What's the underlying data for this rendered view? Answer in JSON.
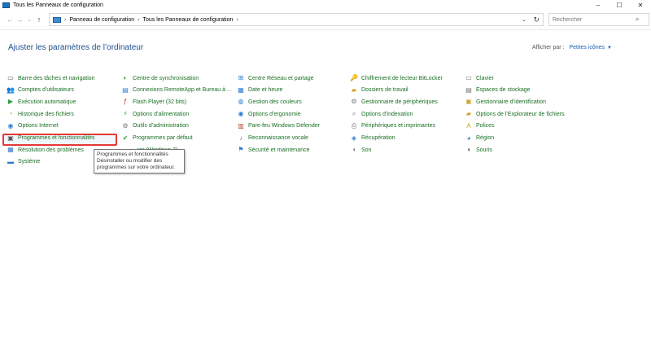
{
  "window": {
    "title": "Tous les Panneaux de configuration",
    "controls": [
      "–",
      "☐",
      "✕"
    ]
  },
  "nav": {
    "back": "←",
    "forward": "→",
    "dropdown": "⌄",
    "up": "↑"
  },
  "address": {
    "separator": "›",
    "crumbs": [
      "Panneau de configuration",
      "Tous les Panneaux de configuration"
    ],
    "dropdown": "⌄",
    "refresh": "↻"
  },
  "search": {
    "placeholder": "Rechercher",
    "icon": "search-icon",
    "icon_glyph": "⌕"
  },
  "heading": "Ajuster les paramètres de l’ordinateur",
  "view_by": {
    "label": "Afficher par :",
    "value": "Petites icônes",
    "caret": "▼"
  },
  "columns": [
    [
      {
        "label": "Barre des tâches et navigation",
        "icon": "taskbar-icon",
        "glyph": "▭",
        "color": "#666666"
      },
      {
        "label": "Comptes d’utilisateurs",
        "icon": "user-accounts-icon",
        "glyph": "👥",
        "color": "#2e7dd1"
      },
      {
        "label": "Exécution automatique",
        "icon": "autoplay-icon",
        "glyph": "▶",
        "color": "#2e9d3e"
      },
      {
        "label": "Historique des fichiers",
        "icon": "file-history-icon",
        "glyph": "◔",
        "color": "#d4a015"
      },
      {
        "label": "Options Internet",
        "icon": "internet-options-icon",
        "glyph": "◉",
        "color": "#2e7dd1"
      },
      {
        "label": "Programmes et fonctionnalités",
        "icon": "programs-icon",
        "glyph": "▣",
        "color": "#555555"
      },
      {
        "label": "Résolution des problèmes",
        "icon": "troubleshoot-icon",
        "glyph": "▦",
        "color": "#2e7dd1"
      },
      {
        "label": "Système",
        "icon": "system-icon",
        "glyph": "▬",
        "color": "#2e7dd1"
      }
    ],
    [
      {
        "label": "Centre de synchronisation",
        "icon": "sync-center-icon",
        "glyph": "◐",
        "color": "#2e9d3e"
      },
      {
        "label": "Connexions RemoteApp et Bureau à ...",
        "icon": "remoteapp-icon",
        "glyph": "▤",
        "color": "#2e7dd1"
      },
      {
        "label": "Flash Player (32 bits)",
        "icon": "flash-player-icon",
        "glyph": "ƒ",
        "color": "#cc2222"
      },
      {
        "label": "Options d’alimentation",
        "icon": "power-options-icon",
        "glyph": "⚡",
        "color": "#3a9d3a"
      },
      {
        "label": "Outils d’administration",
        "icon": "admin-tools-icon",
        "glyph": "⚙",
        "color": "#777777"
      },
      {
        "label": "Programmes par défaut",
        "icon": "default-programs-icon",
        "glyph": "✔",
        "color": "#2e9d3e"
      },
      {
        "label": "...rer (Windows 7)",
        "icon": "backup-restore-icon",
        "glyph": "",
        "color": "#777777"
      }
    ],
    [
      {
        "label": "Centre Réseau et partage",
        "icon": "network-center-icon",
        "glyph": "⊞",
        "color": "#2e7dd1"
      },
      {
        "label": "Date et heure",
        "icon": "date-time-icon",
        "glyph": "▦",
        "color": "#2e7dd1"
      },
      {
        "label": "Gestion des couleurs",
        "icon": "color-management-icon",
        "glyph": "◍",
        "color": "#2e7dd1"
      },
      {
        "label": "Options d’ergonomie",
        "icon": "ease-of-access-icon",
        "glyph": "◉",
        "color": "#2e7dd1"
      },
      {
        "label": "Pare-feu Windows Defender",
        "icon": "firewall-icon",
        "glyph": "▥",
        "color": "#b8452a"
      },
      {
        "label": "Reconnaissance vocale",
        "icon": "speech-recognition-icon",
        "glyph": "♪",
        "color": "#777777"
      },
      {
        "label": "Sécurité et maintenance",
        "icon": "security-maintenance-icon",
        "glyph": "⚑",
        "color": "#2e7dd1"
      }
    ],
    [
      {
        "label": "Chiffrement de lecteur BitLocker",
        "icon": "bitlocker-icon",
        "glyph": "🔑",
        "color": "#c9a227"
      },
      {
        "label": "Dossiers de travail",
        "icon": "work-folders-icon",
        "glyph": "▰",
        "color": "#d4a015"
      },
      {
        "label": "Gestionnaire de périphériques",
        "icon": "device-manager-icon",
        "glyph": "⚙",
        "color": "#777777"
      },
      {
        "label": "Options d’indexation",
        "icon": "indexing-options-icon",
        "glyph": "⌕",
        "color": "#777777"
      },
      {
        "label": "Périphériques et imprimantes",
        "icon": "devices-printers-icon",
        "glyph": "⎙",
        "color": "#777777"
      },
      {
        "label": "Récupération",
        "icon": "recovery-icon",
        "glyph": "◈",
        "color": "#2e7dd1"
      },
      {
        "label": "Son",
        "icon": "sound-icon",
        "glyph": "◖",
        "color": "#777777"
      }
    ],
    [
      {
        "label": "Clavier",
        "icon": "keyboard-icon",
        "glyph": "▭",
        "color": "#777777"
      },
      {
        "label": "Espaces de stockage",
        "icon": "storage-spaces-icon",
        "glyph": "▤",
        "color": "#777777"
      },
      {
        "label": "Gestionnaire d’identification",
        "icon": "credential-manager-icon",
        "glyph": "▣",
        "color": "#c9a227"
      },
      {
        "label": "Options de l’Explorateur de fichiers",
        "icon": "explorer-options-icon",
        "glyph": "▰",
        "color": "#d4a015"
      },
      {
        "label": "Polices",
        "icon": "fonts-icon",
        "glyph": "A",
        "color": "#d4a015"
      },
      {
        "label": "Région",
        "icon": "region-icon",
        "glyph": "◕",
        "color": "#2e7dd1"
      },
      {
        "label": "Souris",
        "icon": "mouse-icon",
        "glyph": "◖",
        "color": "#555555"
      }
    ]
  ],
  "tooltip": {
    "title": "Programmes et fonctionnalités",
    "description": "Désinstaller ou modifier des programmes sur votre ordinateur."
  }
}
